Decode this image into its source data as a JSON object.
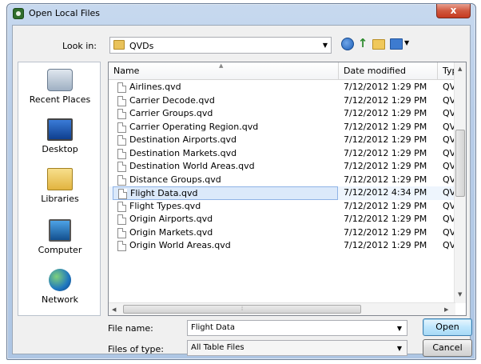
{
  "window": {
    "title": "Open Local Files",
    "close_glyph": "x"
  },
  "lookin": {
    "label": "Look in:",
    "value": "QVDs"
  },
  "places": [
    {
      "label": "Recent Places",
      "icon": "recent-places-icon"
    },
    {
      "label": "Desktop",
      "icon": "desktop-icon"
    },
    {
      "label": "Libraries",
      "icon": "libraries-icon"
    },
    {
      "label": "Computer",
      "icon": "computer-icon"
    },
    {
      "label": "Network",
      "icon": "network-icon"
    }
  ],
  "columns": {
    "name": "Name",
    "date": "Date modified",
    "type": "Type"
  },
  "files": [
    {
      "name": "Airlines.qvd",
      "date": "7/12/2012 1:29 PM",
      "type": "QVD Fi"
    },
    {
      "name": "Carrier Decode.qvd",
      "date": "7/12/2012 1:29 PM",
      "type": "QVD Fi"
    },
    {
      "name": "Carrier Groups.qvd",
      "date": "7/12/2012 1:29 PM",
      "type": "QVD Fi"
    },
    {
      "name": "Carrier Operating Region.qvd",
      "date": "7/12/2012 1:29 PM",
      "type": "QVD Fi"
    },
    {
      "name": "Destination Airports.qvd",
      "date": "7/12/2012 1:29 PM",
      "type": "QVD Fi"
    },
    {
      "name": "Destination Markets.qvd",
      "date": "7/12/2012 1:29 PM",
      "type": "QVD Fi"
    },
    {
      "name": "Destination World Areas.qvd",
      "date": "7/12/2012 1:29 PM",
      "type": "QVD Fi"
    },
    {
      "name": "Distance Groups.qvd",
      "date": "7/12/2012 1:29 PM",
      "type": "QVD Fi"
    },
    {
      "name": "Flight Data.qvd",
      "date": "7/12/2012 4:34 PM",
      "type": "QVD Fi",
      "selected": true
    },
    {
      "name": "Flight Types.qvd",
      "date": "7/12/2012 1:29 PM",
      "type": "QVD Fi"
    },
    {
      "name": "Origin Airports.qvd",
      "date": "7/12/2012 1:29 PM",
      "type": "QVD Fi"
    },
    {
      "name": "Origin Markets.qvd",
      "date": "7/12/2012 1:29 PM",
      "type": "QVD Fi"
    },
    {
      "name": "Origin World Areas.qvd",
      "date": "7/12/2012 1:29 PM",
      "type": "QVD Fi"
    }
  ],
  "filename": {
    "label": "File name:",
    "value": "Flight Data"
  },
  "filetype": {
    "label": "Files of type:",
    "value": "All Table Files"
  },
  "buttons": {
    "open": "Open",
    "cancel": "Cancel"
  }
}
